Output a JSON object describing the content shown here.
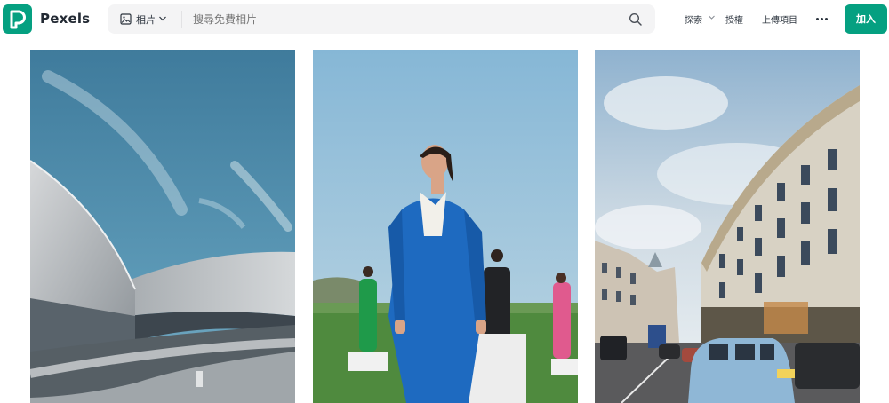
{
  "header": {
    "brand": "Pexels",
    "search": {
      "type_label": "相片",
      "placeholder": "搜尋免費相片"
    },
    "nav": {
      "explore": "探索",
      "license": "授權",
      "upload": "上傳項目",
      "join": "加入"
    }
  },
  "colors": {
    "brand": "#05a081",
    "search_bg": "#f4f4f5",
    "text": "#2c343e"
  },
  "icons": [
    "pexels-logo-icon",
    "image-icon",
    "chevron-down-icon",
    "search-icon",
    "more-icon"
  ],
  "gallery": {
    "photos": [
      {
        "subject": "curved-modern-building"
      },
      {
        "subject": "woman-in-blue-suit"
      },
      {
        "subject": "regent-street-london"
      }
    ]
  }
}
